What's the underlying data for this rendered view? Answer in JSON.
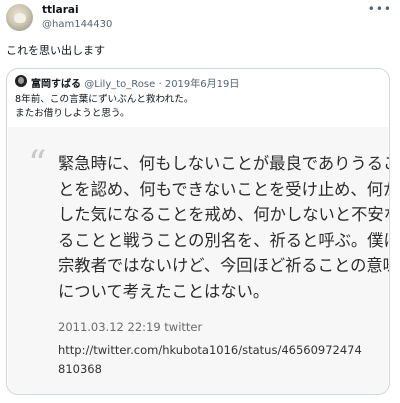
{
  "tweet": {
    "display_name": "ttlarai",
    "handle": "@ham144430",
    "more_icon": "ellipsis-icon",
    "text": "これを思い出します"
  },
  "quoted": {
    "display_name": "富岡すばる",
    "handle": "@Lily_to_Rose",
    "separator": "·",
    "date": "2019年6月19日",
    "lines": [
      "8年前、この言葉にずいぶんと救われた。",
      "またお借りしようと思う。"
    ]
  },
  "image": {
    "quote_glyph": "“",
    "lines": [
      "緊急時に、何もしないことが最良でありうるこ",
      "とを認め、何もできないことを受け止め、何か",
      "した気になることを戒め、何かしないと不安な",
      "ることと戦うことの別名を、祈ると呼ぶ。僕は",
      "宗教者ではないけど、今回ほど祈ることの意味",
      "について考えたことはない。"
    ],
    "meta": "2011.03.12 22:19 twitter",
    "link_lines": [
      "http://twitter.com/hkubota1016/status/46560972474",
      "810368"
    ]
  },
  "colors": {
    "border": "#cfd9de",
    "secondary_text": "#536471",
    "card_bg": "#f7f7f7"
  }
}
